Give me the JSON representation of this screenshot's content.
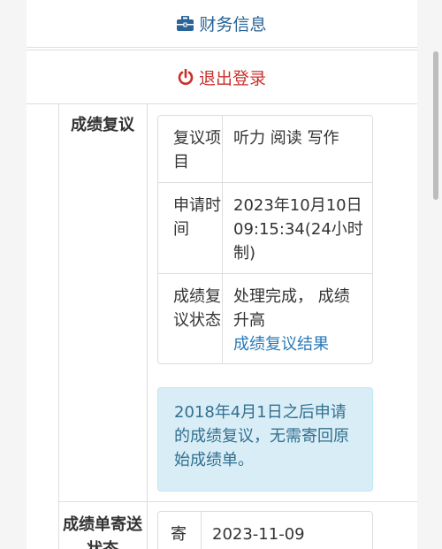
{
  "menu": {
    "finance": {
      "label": "财务信息",
      "icon": "briefcase-icon",
      "color": "#2a6496"
    },
    "logout": {
      "label": "退出登录",
      "icon": "power-icon",
      "color": "#c9302c"
    }
  },
  "review_section": {
    "label": "成绩复议",
    "rows": [
      {
        "key": "复议项目",
        "value": "听力 阅读 写作"
      },
      {
        "key": "申请时间",
        "value": "2023年10月10日 09:15:34(24小时制)"
      },
      {
        "key": "成绩复议状态",
        "value": "处理完成， 成绩升高",
        "link": "成绩复议结果"
      }
    ],
    "notice": "2018年4月1日之后申请的成绩复议，无需寄回原始成绩单。"
  },
  "mail_section": {
    "label": "成绩单寄送状态",
    "rows": [
      {
        "key": "寄",
        "value": "2023-11-09"
      }
    ]
  },
  "colors": {
    "alert_bg": "#d9edf7",
    "alert_text": "#31708f",
    "link": "#2a7ab8"
  }
}
